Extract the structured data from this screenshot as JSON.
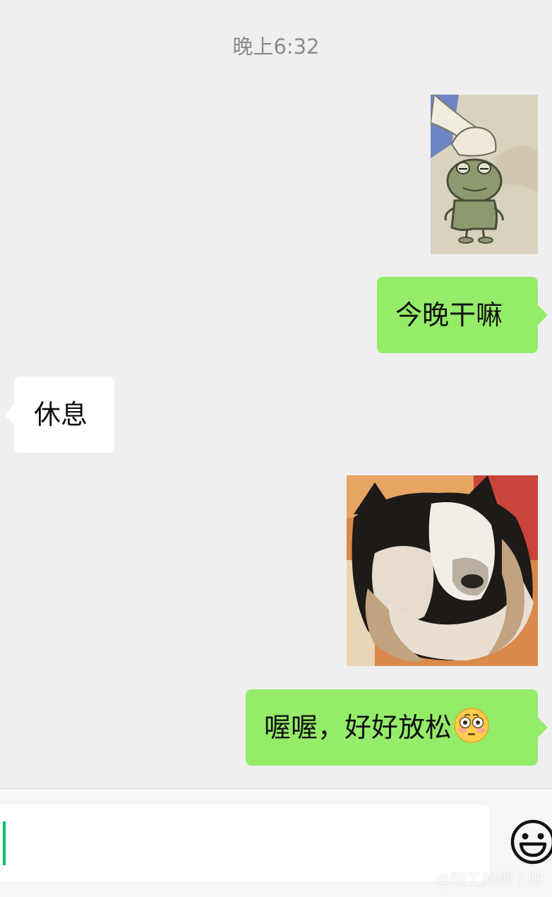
{
  "conversation": {
    "timestamp": "晚上6:32",
    "messages": [
      {
        "type": "sticker",
        "direction": "out",
        "icon": "frog-sticker"
      },
      {
        "type": "text",
        "direction": "out",
        "text": "今晚干嘛"
      },
      {
        "type": "text",
        "direction": "in",
        "text": "休息"
      },
      {
        "type": "sticker",
        "direction": "out",
        "icon": "dog-facepalm-sticker"
      },
      {
        "type": "text",
        "direction": "out",
        "text": "喔喔，好好放松",
        "trailing_emoji": "flushed-face-icon"
      }
    ]
  },
  "input": {
    "value": "",
    "emoji_button_icon": "smiley-face-icon"
  },
  "watermark": {
    "text": "@精工的脚丫吧"
  },
  "colors": {
    "outgoing_bubble": "#95ec69",
    "incoming_bubble": "#ffffff",
    "background": "#efefef",
    "caret": "#07c160"
  }
}
